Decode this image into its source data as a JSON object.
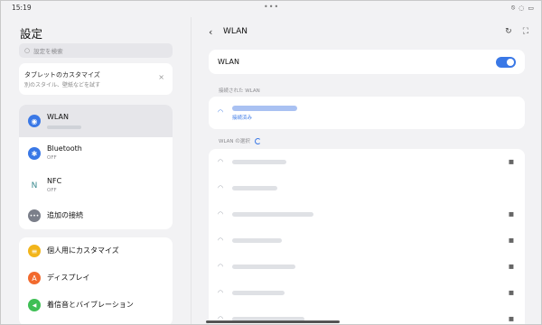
{
  "status": {
    "time": "15:19",
    "dots": "•••",
    "icons": [
      "do-not-disturb-icon",
      "wifi-off-icon",
      "battery-icon"
    ]
  },
  "left": {
    "title": "設定",
    "search_placeholder": "設定を検索",
    "promo": {
      "title": "タブレットのカスタマイズ",
      "subtitle": "別のスタイル、壁紙などを試す",
      "close": "×"
    },
    "items": [
      {
        "label": "WLAN",
        "sub": "",
        "icon": "wifi-icon",
        "color": "#3a78e6",
        "glyph": "◉",
        "selected": true
      },
      {
        "label": "Bluetooth",
        "sub": "OFF",
        "icon": "bluetooth-icon",
        "color": "#3a78e6",
        "glyph": "✱"
      },
      {
        "label": "NFC",
        "sub": "OFF",
        "icon": "nfc-icon",
        "color": "#ffffff",
        "glyph": "N"
      },
      {
        "label": "追加の接続",
        "sub": "",
        "icon": "more-connections-icon",
        "color": "#7b7f8a",
        "glyph": "•••"
      }
    ],
    "items2": [
      {
        "label": "個人用にカスタマイズ",
        "icon": "personalize-icon",
        "color": "#f2b51b",
        "glyph": "≡"
      },
      {
        "label": "ディスプレイ",
        "icon": "display-icon",
        "color": "#f26a2e",
        "glyph": "A"
      },
      {
        "label": "着信音とバイブレーション",
        "icon": "sound-icon",
        "color": "#3fbf55",
        "glyph": "◀"
      }
    ]
  },
  "right": {
    "title": "WLAN",
    "wlan_label": "WLAN",
    "wlan_on": true,
    "connected_header": "接続された WLAN",
    "connected_status": "接続済み",
    "select_header": "WLAN の選択",
    "networks": [
      {
        "locked": true
      },
      {
        "locked": false
      },
      {
        "locked": true
      },
      {
        "locked": true
      },
      {
        "locked": true
      },
      {
        "locked": true
      },
      {
        "locked": true
      }
    ]
  },
  "colors": {
    "accent": "#3a78e6",
    "background": "#f2f2f4"
  }
}
